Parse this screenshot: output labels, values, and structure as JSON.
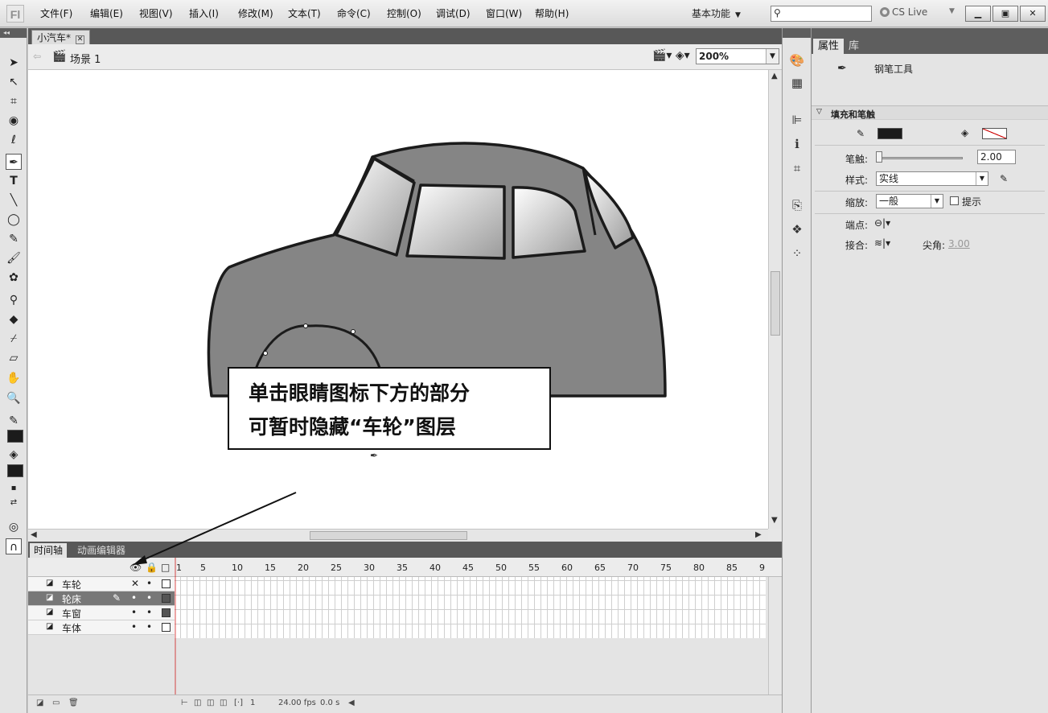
{
  "app": {
    "logo": "Fl"
  },
  "menu": [
    "文件(F)",
    "编辑(E)",
    "视图(V)",
    "插入(I)",
    "修改(M)",
    "文本(T)",
    "命令(C)",
    "控制(O)",
    "调试(D)",
    "窗口(W)",
    "帮助(H)"
  ],
  "workspace": "基本功能",
  "search": {
    "placeholder": ""
  },
  "cslive": "CS Live",
  "document": {
    "tab": "小汽车*",
    "scene": "场景 1",
    "zoom": "200%"
  },
  "callout": {
    "line1": "单击眼睛图标下方的部分",
    "line2": "可暂时隐藏“车轮”图层"
  },
  "timeline": {
    "tabs": [
      "时间轴",
      "动画编辑器"
    ],
    "frame_numbers": [
      "1",
      "5",
      "10",
      "15",
      "20",
      "25",
      "30",
      "35",
      "40",
      "45",
      "50",
      "55",
      "60",
      "65",
      "70",
      "75",
      "80",
      "85",
      "9"
    ],
    "layers": [
      {
        "name": "车轮",
        "visible": "✕",
        "lock": "•"
      },
      {
        "name": "轮床",
        "visible": "•",
        "lock": "•"
      },
      {
        "name": "车窗",
        "visible": "•",
        "lock": "•"
      },
      {
        "name": "车体",
        "visible": "•",
        "lock": "•"
      }
    ],
    "current_frame": "1",
    "fps": "24.00 fps",
    "time": "0.0 s"
  },
  "properties": {
    "tabs": [
      "属性",
      "库"
    ],
    "tool_name": "钢笔工具",
    "section": "填充和笔触",
    "stroke_label": "笔触:",
    "stroke_value": "2.00",
    "style_label": "样式:",
    "style_value": "实线",
    "scale_label": "缩放:",
    "scale_value": "一般",
    "hint_label": "提示",
    "cap_label": "端点:",
    "join_label": "接合:",
    "miter_label": "尖角:",
    "miter_value": "3.00"
  },
  "colors": {
    "stroke": "#1b1b1b",
    "car_body": "#858585",
    "stage": "#ffffff"
  }
}
